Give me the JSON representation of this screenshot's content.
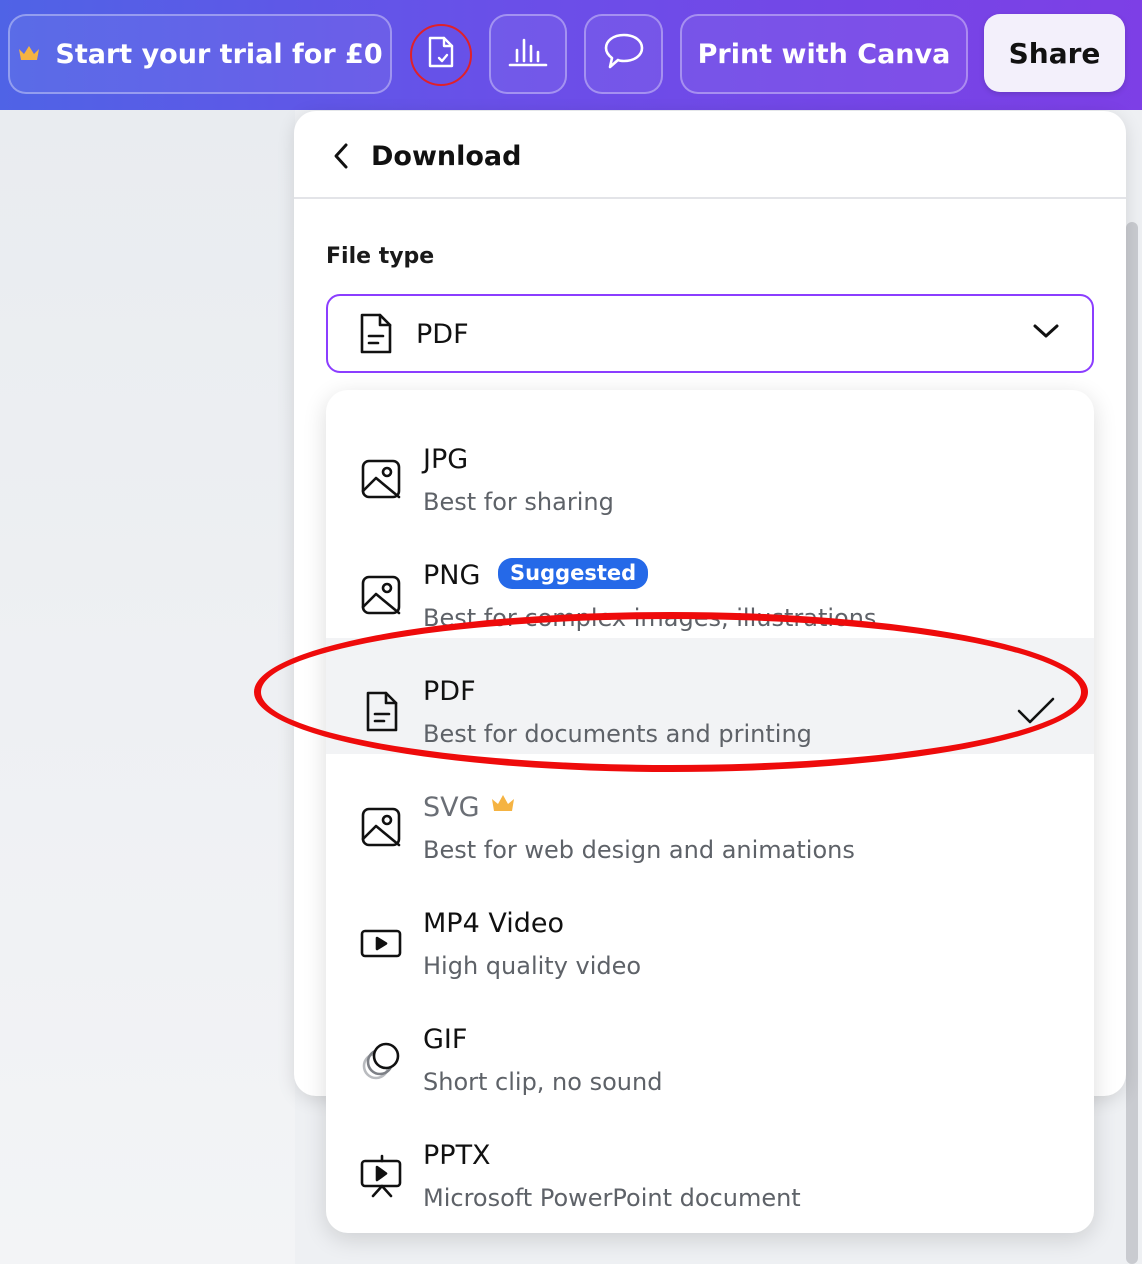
{
  "topbar": {
    "trial_label": "Start your trial for £0",
    "print_label": "Print with Canva",
    "share_label": "Share",
    "icons": [
      "crown-icon",
      "file-check-icon",
      "chart-icon",
      "comment-icon"
    ],
    "gradient_colors": [
      "#4f63e6",
      "#7d3fe6"
    ]
  },
  "panel": {
    "title": "Download",
    "file_type_label": "File type",
    "selected_value": "PDF"
  },
  "dropdown": {
    "options": [
      {
        "name": "JPG",
        "desc": "Best for sharing",
        "icon": "image-icon"
      },
      {
        "name": "PNG",
        "desc": "Best for complex images, illustrations",
        "icon": "image-icon",
        "badge": "Suggested"
      },
      {
        "name": "PDF",
        "desc": "Best for documents and printing",
        "icon": "document-icon",
        "selected": true
      },
      {
        "name": "SVG",
        "desc": "Best for web design and animations",
        "icon": "image-icon",
        "premium": true
      },
      {
        "name": "MP4 Video",
        "desc": "High quality video",
        "icon": "video-icon"
      },
      {
        "name": "GIF",
        "desc": "Short clip, no sound",
        "icon": "gif-icon"
      },
      {
        "name": "PPTX",
        "desc": "Microsoft PowerPoint document",
        "icon": "presentation-icon"
      }
    ]
  },
  "colors": {
    "accent": "#8b3dff",
    "badge": "#2569e8",
    "annotation": "#ee0b0b",
    "crown": "#f5a623"
  }
}
